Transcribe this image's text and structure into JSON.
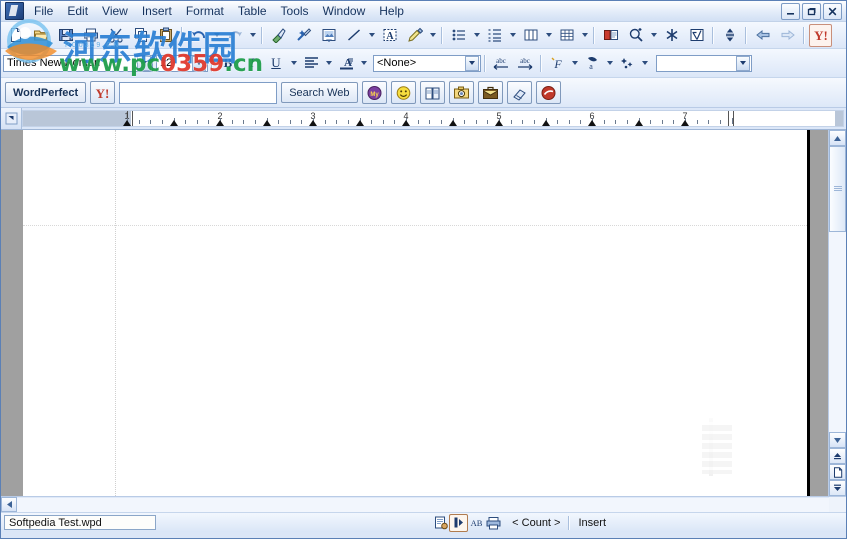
{
  "window": {
    "app_icon": "wordperfect-icon",
    "controls": [
      {
        "name": "minimize-button",
        "glyph": "—"
      },
      {
        "name": "restore-button",
        "glyph": "❐"
      },
      {
        "name": "close-button",
        "glyph": "✕"
      }
    ]
  },
  "menu": {
    "items": [
      {
        "label": "File"
      },
      {
        "label": "Edit"
      },
      {
        "label": "View"
      },
      {
        "label": "Insert"
      },
      {
        "label": "Format"
      },
      {
        "label": "Table"
      },
      {
        "label": "Tools"
      },
      {
        "label": "Window"
      },
      {
        "label": "Help"
      }
    ]
  },
  "toolbar": {
    "groups": [
      {
        "buttons": [
          {
            "name": "new-blank-document-button",
            "icon": "new-document-icon"
          },
          {
            "name": "open-button",
            "icon": "open-folder-icon"
          },
          {
            "name": "save-button",
            "icon": "floppy-disk-icon"
          },
          {
            "name": "print-button",
            "icon": "printer-icon"
          },
          {
            "name": "cut-button",
            "icon": "scissors-icon"
          },
          {
            "name": "copy-button",
            "icon": "copy-icon"
          },
          {
            "name": "paste-button",
            "icon": "clipboard-icon"
          }
        ]
      },
      {
        "buttons": [
          {
            "name": "undo-button",
            "icon": "undo-arrow-icon",
            "has_dropdown": true
          },
          {
            "name": "redo-button",
            "icon": "redo-arrow-icon",
            "has_dropdown": true
          }
        ]
      },
      {
        "buttons": [
          {
            "name": "format-painter-button",
            "icon": "paintbrush-icon"
          },
          {
            "name": "quickformat-button",
            "icon": "quickformat-icon"
          },
          {
            "name": "insert-image-button",
            "icon": "picture-icon"
          },
          {
            "name": "draw-line-button",
            "icon": "line-icon",
            "has_dropdown": true
          },
          {
            "name": "text-box-button",
            "icon": "text-box-icon"
          },
          {
            "name": "highlighter-button",
            "icon": "highlighter-pen-icon",
            "has_dropdown": true
          }
        ]
      },
      {
        "buttons": [
          {
            "name": "bullets-button",
            "icon": "bulleted-list-icon",
            "has_dropdown": true
          },
          {
            "name": "numbering-button",
            "icon": "numbered-list-icon",
            "has_dropdown": true
          },
          {
            "name": "columns-button",
            "icon": "columns-icon",
            "has_dropdown": true
          },
          {
            "name": "table-button",
            "icon": "table-grid-icon",
            "has_dropdown": true
          }
        ]
      },
      {
        "buttons": [
          {
            "name": "dictionary-button",
            "icon": "open-book-icon"
          },
          {
            "name": "zoom-button",
            "icon": "magnifier-plus-icon",
            "has_dropdown": true
          },
          {
            "name": "symbols-button",
            "icon": "asterisk-icon"
          },
          {
            "name": "equation-button",
            "icon": "equation-editor-icon"
          }
        ]
      },
      {
        "buttons": [
          {
            "name": "line-spacing-button",
            "icon": "updown-arrows-icon"
          }
        ]
      },
      {
        "buttons": [
          {
            "name": "browse-back-button",
            "icon": "left-arrow-icon"
          },
          {
            "name": "browse-forward-button",
            "icon": "right-arrow-icon"
          }
        ]
      },
      {
        "buttons": [
          {
            "name": "yahoo-button",
            "icon": "yahoo-y-icon"
          }
        ]
      }
    ]
  },
  "property_bar": {
    "font_name": "Times New Roman",
    "font_size": "12",
    "bold_label": "B",
    "italic_label": "I",
    "underline_label": "U",
    "style_value": "<None>",
    "buttons": [
      {
        "name": "bold-button",
        "icon": "bold-icon"
      },
      {
        "name": "italic-button",
        "icon": "italic-icon"
      },
      {
        "name": "underline-button",
        "icon": "underline-icon",
        "has_dropdown": true
      },
      {
        "name": "justification-button",
        "icon": "align-left-icon",
        "has_dropdown": true
      },
      {
        "name": "font-color-button",
        "icon": "font-color-icon",
        "has_dropdown": true
      },
      {
        "name": "previous-paragraph-button",
        "icon": "abc-left-arrow-icon"
      },
      {
        "name": "next-paragraph-button",
        "icon": "abc-right-arrow-icon"
      },
      {
        "name": "quickfonts-button",
        "icon": "script-f-icon",
        "has_dropdown": true
      },
      {
        "name": "highlight-color-button",
        "icon": "highlight-a-icon",
        "has_dropdown": true
      },
      {
        "name": "symbols-insert-button",
        "icon": "sparkle-symbol-icon",
        "has_dropdown": true
      }
    ],
    "outline_value": ""
  },
  "yahoo_bar": {
    "brand_label": "WordPerfect",
    "logo_icon": "yahoo-y-icon",
    "search_value": "",
    "search_placeholder": "",
    "search_button_label": "Search Web",
    "buttons": [
      {
        "name": "my-yahoo-button",
        "icon": "my-yahoo-icon"
      },
      {
        "name": "messenger-button",
        "icon": "smiley-face-icon"
      },
      {
        "name": "bookmarks-button",
        "icon": "open-book-icon"
      },
      {
        "name": "photos-button",
        "icon": "camera-icon"
      },
      {
        "name": "briefcase-button",
        "icon": "briefcase-icon"
      },
      {
        "name": "highlight-eraser-button",
        "icon": "eraser-icon"
      },
      {
        "name": "yahoo-services-button",
        "icon": "red-circle-icon"
      }
    ]
  },
  "ruler": {
    "corner_icon": "tab-selector-icon",
    "numbers": [
      "1",
      "2",
      "3",
      "4",
      "5",
      "6",
      "7"
    ],
    "tab_stops": [
      "1",
      "1.5",
      "2",
      "2.5",
      "3",
      "3.5",
      "4",
      "4.5",
      "5",
      "5.5",
      "6",
      "6.5",
      "7"
    ],
    "left_margin": "1",
    "right_margin": "7.5"
  },
  "document": {
    "page_content": "",
    "scrollbars": {
      "vertical": {
        "up_icon": "chevron-up-icon",
        "down_icon": "chevron-down-icon",
        "prev_page_icon": "previous-page-icon",
        "page_icon": "page-icon",
        "next_page_icon": "next-page-icon"
      },
      "horizontal": {
        "left_icon": "chevron-left-icon",
        "right_icon": "chevron-right-icon"
      }
    }
  },
  "status_bar": {
    "filename": "Softpedia Test.wpd",
    "icons": [
      {
        "name": "shadow-cursor-icon",
        "glyph": "▤"
      },
      {
        "name": "insert-mode-icon",
        "glyph": "I"
      },
      {
        "name": "caps-indicator-icon",
        "glyph": "AB"
      },
      {
        "name": "printer-status-icon",
        "glyph": "🖶"
      }
    ],
    "count_label": "< Count >",
    "insert_label": "Insert"
  },
  "watermark": {
    "site_name_cn": "河东软件园",
    "site_url": "www.pc0359.cn",
    "sub_text": "PC0359.CN",
    "url_accent_color": "#e03b2f",
    "url_color": "#1f9e4b",
    "cn_color": "#2a7fd4"
  }
}
